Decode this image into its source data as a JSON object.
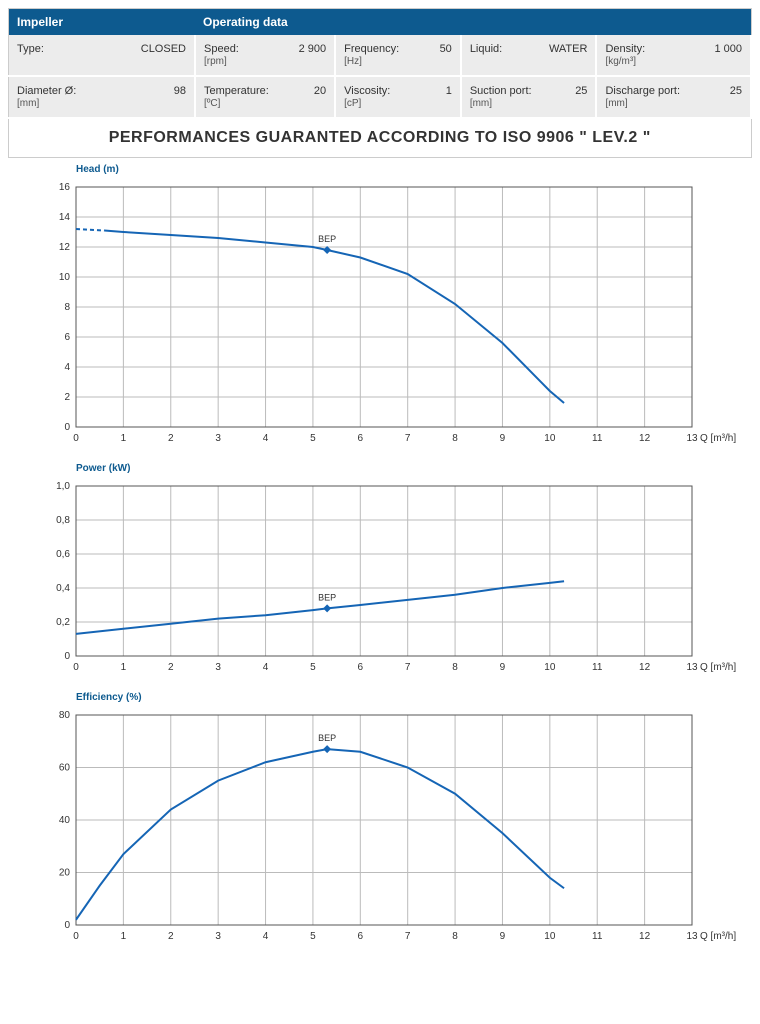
{
  "header": {
    "impeller": "Impeller",
    "opdata": "Operating data"
  },
  "spec": {
    "type_lbl": "Type:",
    "type_val": "CLOSED",
    "diam_lbl": "Diameter Ø:",
    "diam_unit": "[mm]",
    "diam_val": "98",
    "speed_lbl": "Speed:",
    "speed_unit": "[rpm]",
    "speed_val": "2 900",
    "temp_lbl": "Temperature:",
    "temp_unit": "[ºC]",
    "temp_val": "20",
    "freq_lbl": "Frequency:",
    "freq_unit": "[Hz]",
    "freq_val": "50",
    "visc_lbl": "Viscosity:",
    "visc_unit": "[cP]",
    "visc_val": "1",
    "liq_lbl": "Liquid:",
    "liq_val": "WATER",
    "suct_lbl": "Suction port:",
    "suct_unit": "[mm]",
    "suct_val": "25",
    "dens_lbl": "Density:",
    "dens_unit": "[kg/m³]",
    "dens_val": "1 000",
    "disch_lbl": "Discharge port:",
    "disch_unit": "[mm]",
    "disch_val": "25"
  },
  "iso_banner": "PERFORMANCES GUARANTED ACCORDING TO ISO 9906 \" LEV.2 \"",
  "labels": {
    "head": "Head (m)",
    "power": "Power (kW)",
    "eff": "Efficiency (%)",
    "xaxis": "Q [m³/h]",
    "bep": "BEP"
  },
  "chart_data": [
    {
      "type": "line",
      "title": "Head (m)",
      "xlabel": "Q [m³/h]",
      "ylabel": "Head (m)",
      "xlim": [
        0,
        13
      ],
      "ylim": [
        0,
        16
      ],
      "x_ticks": [
        0,
        1,
        2,
        3,
        4,
        5,
        6,
        7,
        8,
        9,
        10,
        11,
        12,
        13
      ],
      "y_ticks": [
        0,
        2,
        4,
        6,
        8,
        10,
        12,
        14,
        16
      ],
      "series": [
        {
          "name": "Head",
          "x": [
            0,
            0.6,
            1,
            2,
            3,
            4,
            5,
            5.3,
            6,
            7,
            8,
            9,
            10,
            10.3
          ],
          "y": [
            13.2,
            13.1,
            13.0,
            12.8,
            12.6,
            12.3,
            12.0,
            11.8,
            11.3,
            10.2,
            8.2,
            5.6,
            2.4,
            1.6
          ]
        }
      ],
      "bep": {
        "x": 5.3,
        "y": 11.8
      }
    },
    {
      "type": "line",
      "title": "Power (kW)",
      "xlabel": "Q [m³/h]",
      "ylabel": "Power (kW)",
      "xlim": [
        0,
        13
      ],
      "ylim": [
        0,
        1.0
      ],
      "x_ticks": [
        0,
        1,
        2,
        3,
        4,
        5,
        6,
        7,
        8,
        9,
        10,
        11,
        12,
        13
      ],
      "y_ticks": [
        0,
        0.2,
        0.4,
        0.6,
        0.8,
        1.0
      ],
      "series": [
        {
          "name": "Power",
          "x": [
            0,
            1,
            2,
            3,
            4,
            5,
            5.3,
            6,
            7,
            8,
            9,
            10,
            10.3
          ],
          "y": [
            0.13,
            0.16,
            0.19,
            0.22,
            0.24,
            0.27,
            0.28,
            0.3,
            0.33,
            0.36,
            0.4,
            0.43,
            0.44
          ]
        }
      ],
      "bep": {
        "x": 5.3,
        "y": 0.28
      }
    },
    {
      "type": "line",
      "title": "Efficiency (%)",
      "xlabel": "Q [m³/h]",
      "ylabel": "Efficiency (%)",
      "xlim": [
        0,
        13
      ],
      "ylim": [
        0,
        80
      ],
      "x_ticks": [
        0,
        1,
        2,
        3,
        4,
        5,
        6,
        7,
        8,
        9,
        10,
        11,
        12,
        13
      ],
      "y_ticks": [
        0,
        20,
        40,
        60,
        80
      ],
      "series": [
        {
          "name": "Efficiency",
          "x": [
            0,
            0.5,
            1,
            2,
            3,
            4,
            5,
            5.3,
            6,
            7,
            8,
            9,
            10,
            10.3
          ],
          "y": [
            2,
            15,
            27,
            44,
            55,
            62,
            66,
            67,
            66,
            60,
            50,
            35,
            18,
            14
          ]
        }
      ],
      "bep": {
        "x": 5.3,
        "y": 67
      }
    }
  ]
}
